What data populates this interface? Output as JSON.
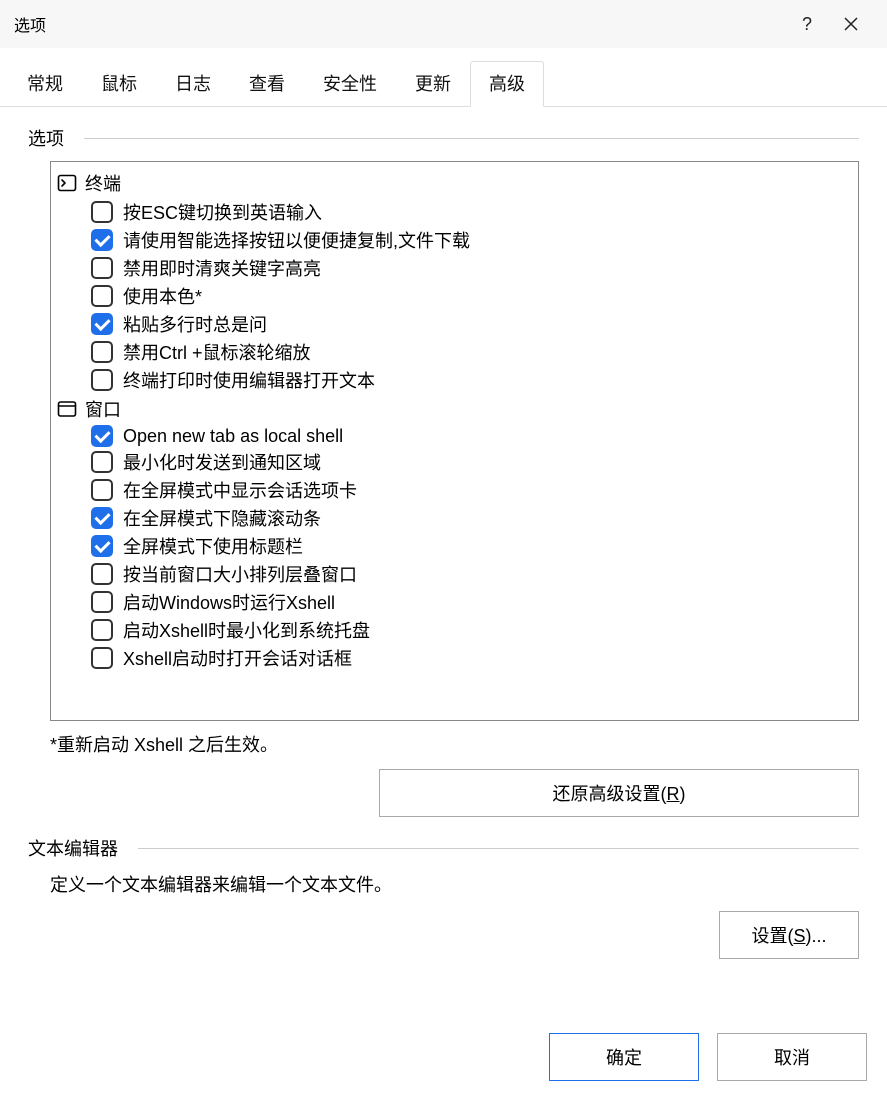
{
  "window": {
    "title": "选项",
    "help": "?",
    "close": "✕"
  },
  "tabs": {
    "items": [
      {
        "label": "常规"
      },
      {
        "label": "鼠标"
      },
      {
        "label": "日志"
      },
      {
        "label": "查看"
      },
      {
        "label": "安全性"
      },
      {
        "label": "更新"
      },
      {
        "label": "高级"
      }
    ],
    "active_index": 6
  },
  "options_section": {
    "label": "选项",
    "groups": [
      {
        "icon": "terminal",
        "label": "终端",
        "items": [
          {
            "checked": false,
            "label": "按ESC键切换到英语输入"
          },
          {
            "checked": true,
            "label": "请使用智能选择按钮以便便捷复制,文件下载"
          },
          {
            "checked": false,
            "label": "禁用即时清爽关键字高亮"
          },
          {
            "checked": false,
            "label": "使用本色*"
          },
          {
            "checked": true,
            "label": "粘贴多行时总是问"
          },
          {
            "checked": false,
            "label": "禁用Ctrl +鼠标滚轮缩放"
          },
          {
            "checked": false,
            "label": "终端打印时使用编辑器打开文本"
          }
        ]
      },
      {
        "icon": "window",
        "label": "窗口",
        "items": [
          {
            "checked": true,
            "label": "Open new tab as local shell"
          },
          {
            "checked": false,
            "label": "最小化时发送到通知区域"
          },
          {
            "checked": false,
            "label": "在全屏模式中显示会话选项卡"
          },
          {
            "checked": true,
            "label": "在全屏模式下隐藏滚动条"
          },
          {
            "checked": true,
            "label": "全屏模式下使用标题栏"
          },
          {
            "checked": false,
            "label": "按当前窗口大小排列层叠窗口"
          },
          {
            "checked": false,
            "label": "启动Windows时运行Xshell"
          },
          {
            "checked": false,
            "label": "启动Xshell时最小化到系统托盘"
          },
          {
            "checked": false,
            "label": "Xshell启动时打开会话对话框"
          }
        ]
      }
    ],
    "note": "*重新启动 Xshell 之后生效。",
    "restore_button": "还原高级设置(R)",
    "restore_hotkey": "R"
  },
  "editor_section": {
    "label": "文本编辑器",
    "description": "定义一个文本编辑器来编辑一个文本文件。",
    "settings_button": "设置(S)...",
    "settings_hotkey": "S"
  },
  "footer": {
    "ok": "确定",
    "cancel": "取消"
  }
}
